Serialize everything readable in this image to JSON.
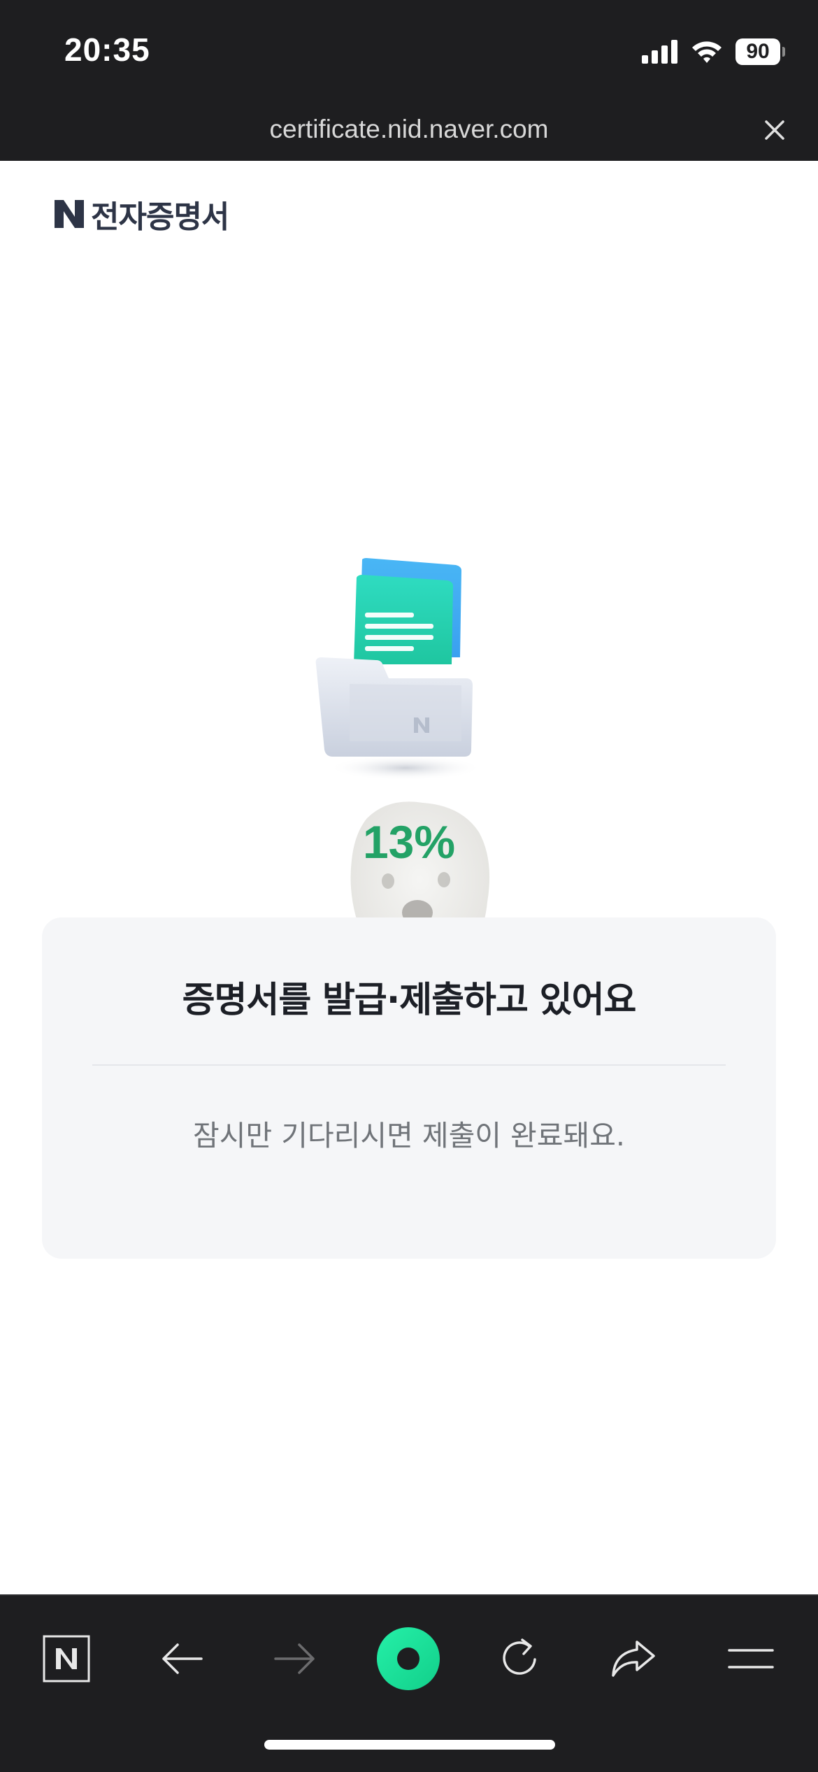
{
  "status_bar": {
    "time": "20:35",
    "battery_level": "90",
    "icons": [
      "cellular-signal-icon",
      "wifi-icon",
      "battery-icon"
    ]
  },
  "browser": {
    "url": "certificate.nid.naver.com",
    "close_icon": "close-icon"
  },
  "page": {
    "logo_letter": "N",
    "logo_text": "전자증명서",
    "progress_text": "13%",
    "title": "증명서를 발급·제출하고 있어요",
    "subtitle": "잠시만 기다리시면 제출이 완료돼요."
  },
  "toolbar": {
    "items": [
      {
        "name": "naver-home-button",
        "icon": "naver-n-icon",
        "enabled": true
      },
      {
        "name": "back-button",
        "icon": "arrow-left-icon",
        "enabled": true
      },
      {
        "name": "forward-button",
        "icon": "arrow-right-icon",
        "enabled": false
      },
      {
        "name": "green-dot-button",
        "icon": "green-dot-icon",
        "enabled": true
      },
      {
        "name": "reload-button",
        "icon": "reload-icon",
        "enabled": true
      },
      {
        "name": "share-button",
        "icon": "share-icon",
        "enabled": true
      },
      {
        "name": "menu-button",
        "icon": "menu-icon",
        "enabled": true
      }
    ]
  },
  "colors": {
    "progress_green": "#23a266",
    "dark_bar": "#1e1e20",
    "card_bg": "#f5f6f8",
    "accent_green_dot": "#1ee6a0"
  }
}
